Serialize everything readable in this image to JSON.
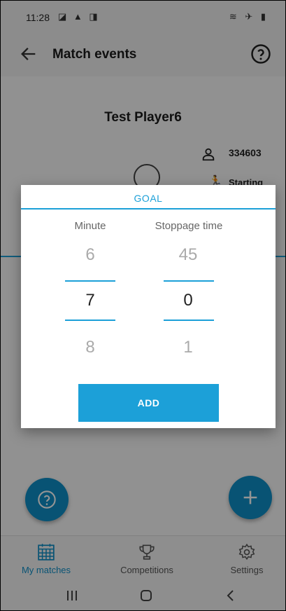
{
  "status_bar": {
    "time": "11:28",
    "left_icons": "◪ ▲ ◨",
    "right_icons": "≋ ✈ ▮"
  },
  "app_bar": {
    "title": "Match events",
    "back_icon": "arrow-left-icon",
    "help_icon": "help-circle-icon"
  },
  "player": {
    "name": "Test Player6",
    "id": "334603",
    "status": "Starting"
  },
  "dialog": {
    "title": "GOAL",
    "minute_label": "Minute",
    "stoppage_label": "Stoppage time",
    "minute": {
      "prev": "6",
      "current": "7",
      "next": "8"
    },
    "stoppage": {
      "prev": "45",
      "current": "0",
      "next": "1"
    },
    "add_label": "ADD"
  },
  "bottom_nav": [
    {
      "label": "My matches",
      "icon": "calendar-grid-icon",
      "active": true
    },
    {
      "label": "Competitions",
      "icon": "trophy-icon",
      "active": false
    },
    {
      "label": "Settings",
      "icon": "gear-icon",
      "active": false
    }
  ],
  "colors": {
    "accent": "#1ca0d8",
    "fab": "#0f90c8"
  }
}
